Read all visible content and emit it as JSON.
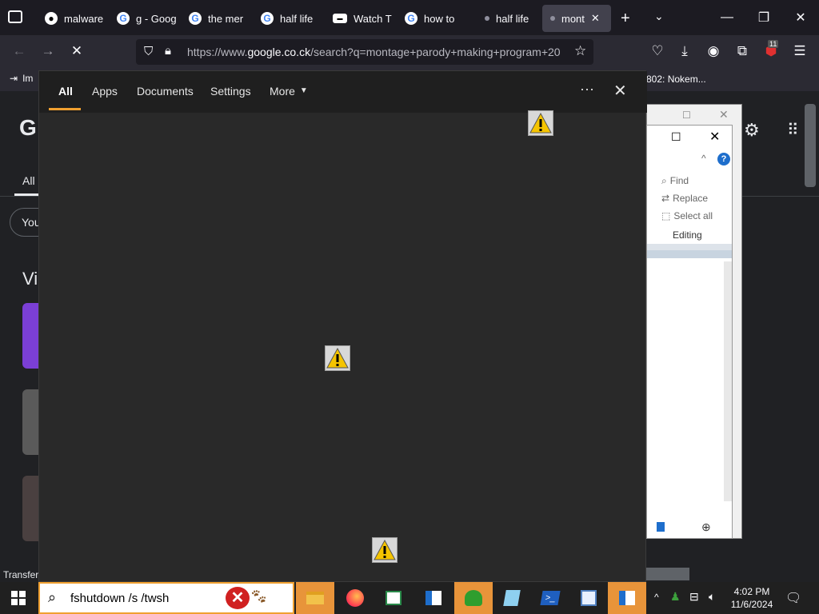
{
  "browser": {
    "tabs": [
      {
        "label": "malware",
        "icon": "github-icon"
      },
      {
        "label": "g - Goog",
        "icon": "google-icon"
      },
      {
        "label": "the mer",
        "icon": "google-icon"
      },
      {
        "label": "half life",
        "icon": "google-icon"
      },
      {
        "label": "Watch T",
        "icon": "site-icon"
      },
      {
        "label": "how to",
        "icon": "google-icon"
      },
      {
        "label": "half life",
        "icon": "dot-icon"
      },
      {
        "label": "mont",
        "icon": "dot-icon",
        "active": true
      }
    ],
    "url_prefix": "https://www.",
    "url_domain": "google.co.ck",
    "url_rest": "/search?q=montage+parody+making+program+20",
    "bookmark_left": "Im",
    "bookmark_right": "802: Nokem...",
    "extensions_badge": "11"
  },
  "page_behind": {
    "google_letter": "G",
    "tab_all": "All",
    "chip": "You",
    "heading": "Vi",
    "status": "Transfer"
  },
  "search_flyout": {
    "tabs": [
      "All",
      "Apps",
      "Documents",
      "Settings",
      "More"
    ],
    "selected_tab": "All"
  },
  "wordpad": {
    "find": "Find",
    "replace": "Replace",
    "select_all": "Select all",
    "group": "Editing"
  },
  "taskbar": {
    "search_text": "fshutdown /s /twsh",
    "time": "4:02 PM",
    "date": "11/6/2024"
  },
  "colors": {
    "accent": "#f0a030",
    "browser_bg": "#1c1b22",
    "toolbar": "#2b2a33"
  }
}
